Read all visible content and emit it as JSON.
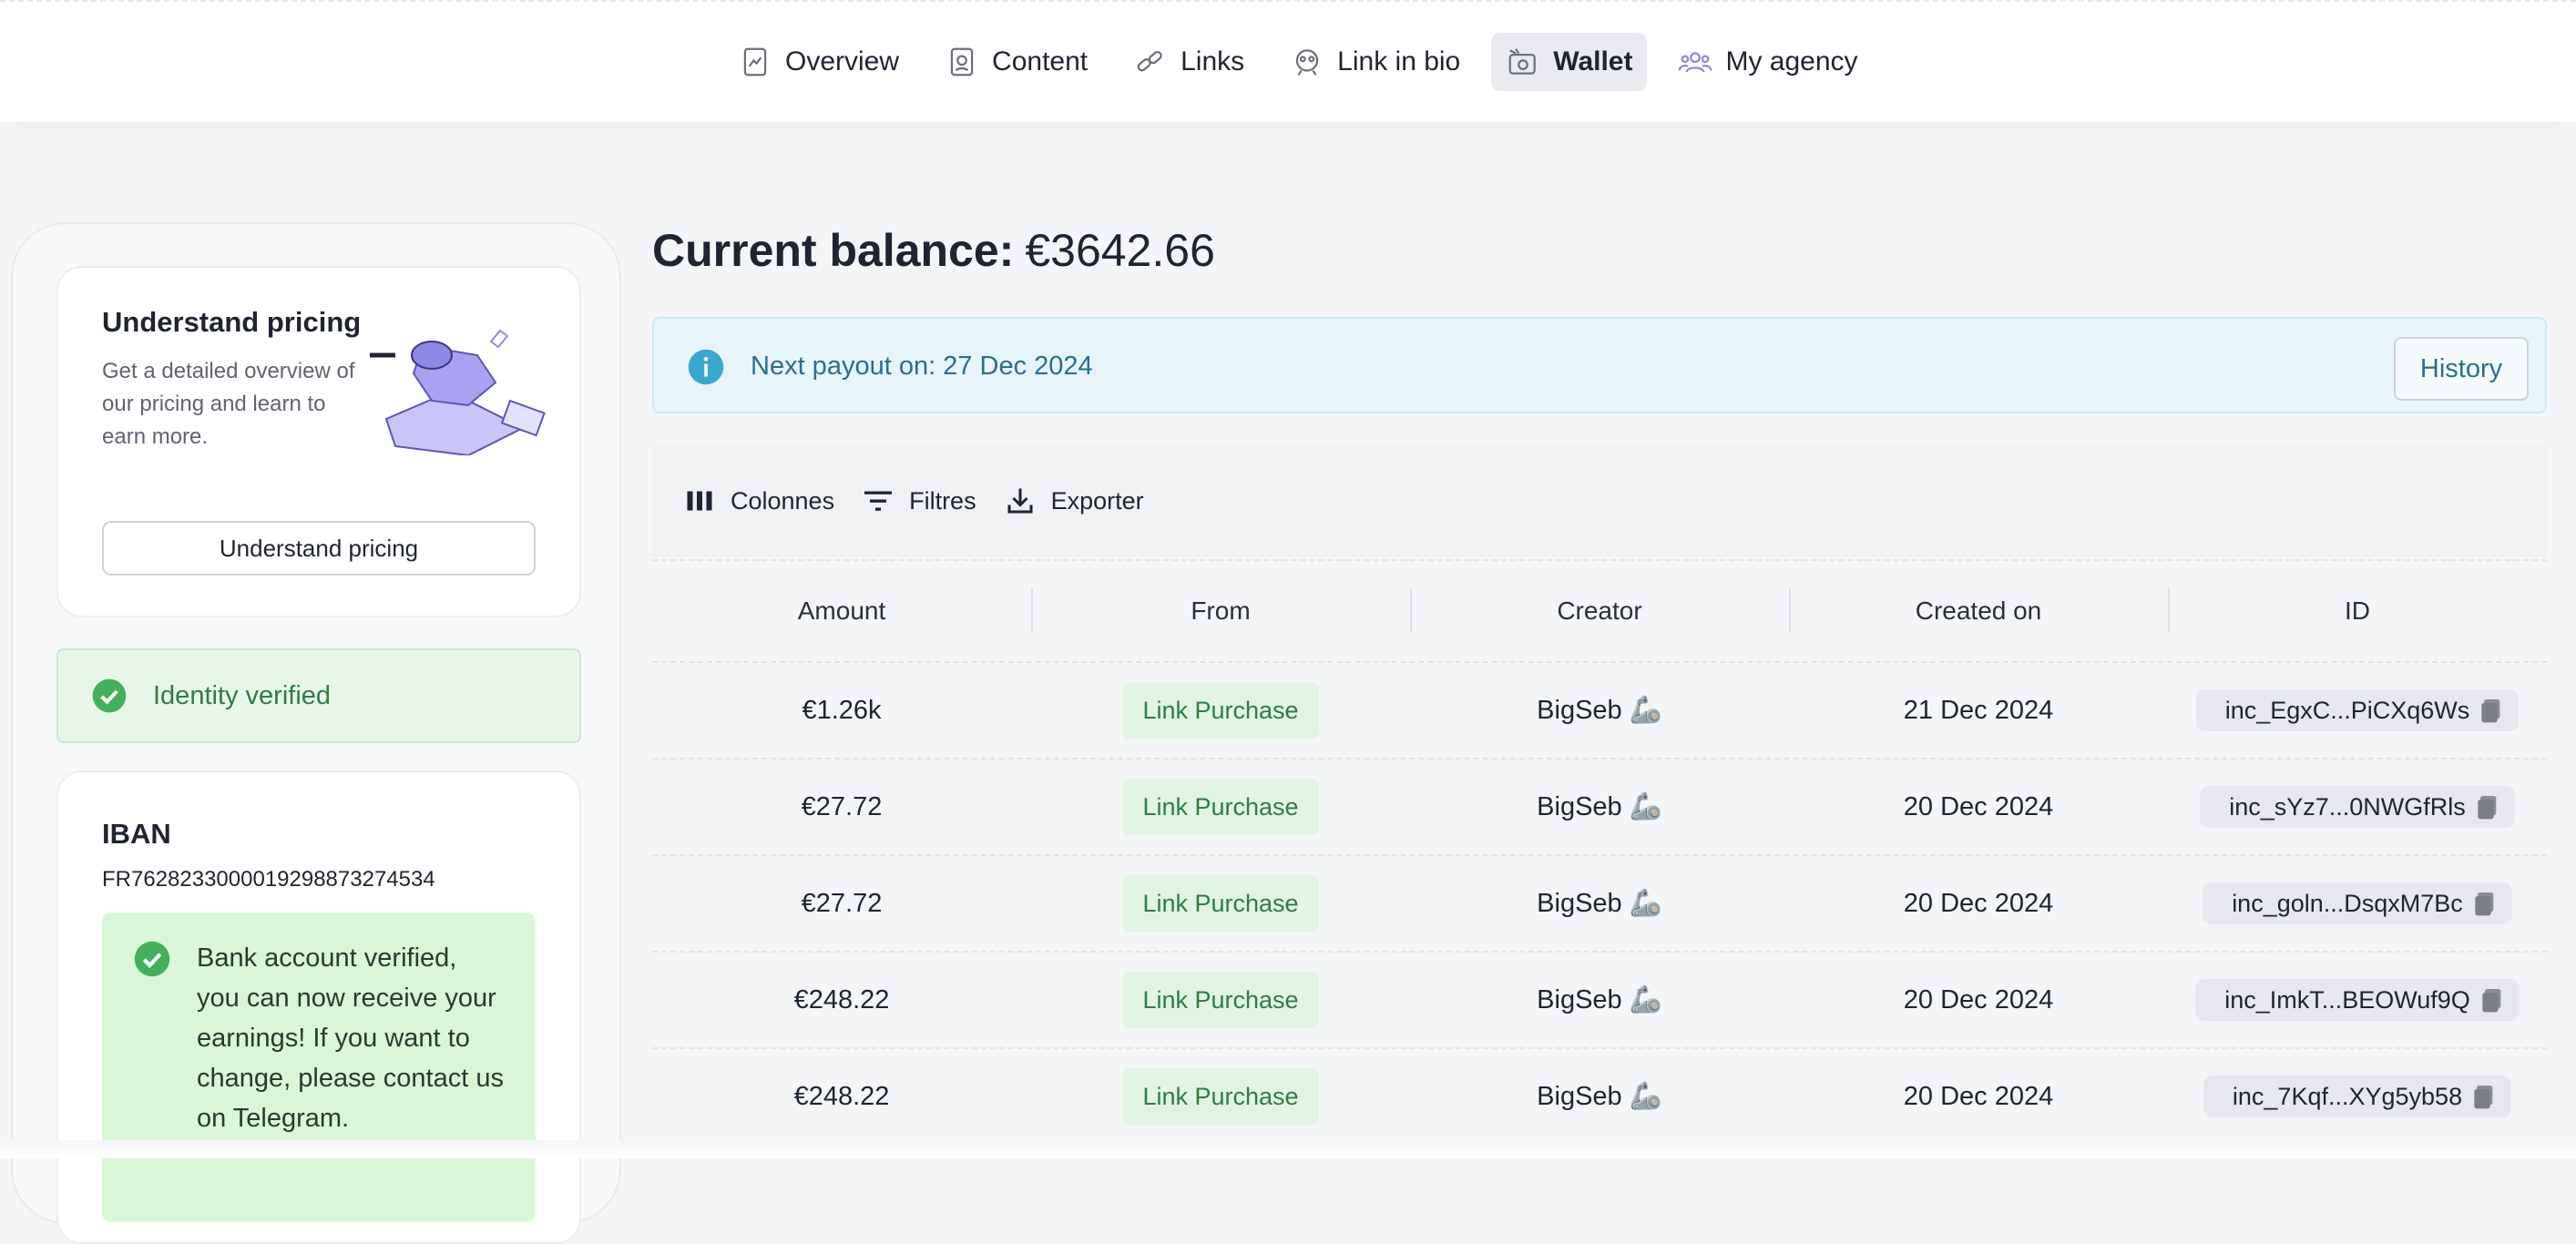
{
  "nav": {
    "tabs": [
      {
        "label": "Overview",
        "icon": "chart-icon"
      },
      {
        "label": "Content",
        "icon": "content-icon"
      },
      {
        "label": "Links",
        "icon": "link-icon"
      },
      {
        "label": "Link in bio",
        "icon": "link-in-bio-icon"
      },
      {
        "label": "Wallet",
        "icon": "wallet-icon",
        "active": true
      },
      {
        "label": "My agency",
        "icon": "agency-icon"
      }
    ]
  },
  "sidebar": {
    "pricing": {
      "title": "Understand pricing",
      "description": "Get a detailed overview of our pricing and learn to earn more.",
      "button_label": "Understand pricing"
    },
    "identity": {
      "label": "Identity verified"
    },
    "iban": {
      "title": "IBAN",
      "value": "FR7628233000019298873274534",
      "verified_message": "Bank account verified, you can now receive your earnings! If you want to change, please contact us on Telegram."
    }
  },
  "main": {
    "balance": {
      "label": "Current balance:",
      "amount": "€3642.66"
    },
    "payout": {
      "text": "Next payout on: 27 Dec 2024",
      "history_label": "History"
    },
    "toolbar": {
      "columns_label": "Colonnes",
      "filters_label": "Filtres",
      "export_label": "Exporter"
    },
    "table": {
      "headers": [
        "Amount",
        "From",
        "Creator",
        "Created on",
        "ID"
      ],
      "rows": [
        {
          "amount": "€1.26k",
          "from": "Link Purchase",
          "creator": "BigSeb 🦾",
          "created": "21 Dec 2024",
          "id": "inc_EgxC...PiCXq6Ws"
        },
        {
          "amount": "€27.72",
          "from": "Link Purchase",
          "creator": "BigSeb 🦾",
          "created": "20 Dec 2024",
          "id": "inc_sYz7...0NWGfRls"
        },
        {
          "amount": "€27.72",
          "from": "Link Purchase",
          "creator": "BigSeb 🦾",
          "created": "20 Dec 2024",
          "id": "inc_goln...DsqxM7Bc"
        },
        {
          "amount": "€248.22",
          "from": "Link Purchase",
          "creator": "BigSeb 🦾",
          "created": "20 Dec 2024",
          "id": "inc_ImkT...BEOWuf9Q"
        },
        {
          "amount": "€248.22",
          "from": "Link Purchase",
          "creator": "BigSeb 🦾",
          "created": "20 Dec 2024",
          "id": "inc_7Kqf...XYg5yb58"
        }
      ]
    }
  },
  "colors": {
    "accent_purple": "#a9a2f2",
    "success_green": "#43b05c",
    "info_blue": "#3aa9cf"
  }
}
